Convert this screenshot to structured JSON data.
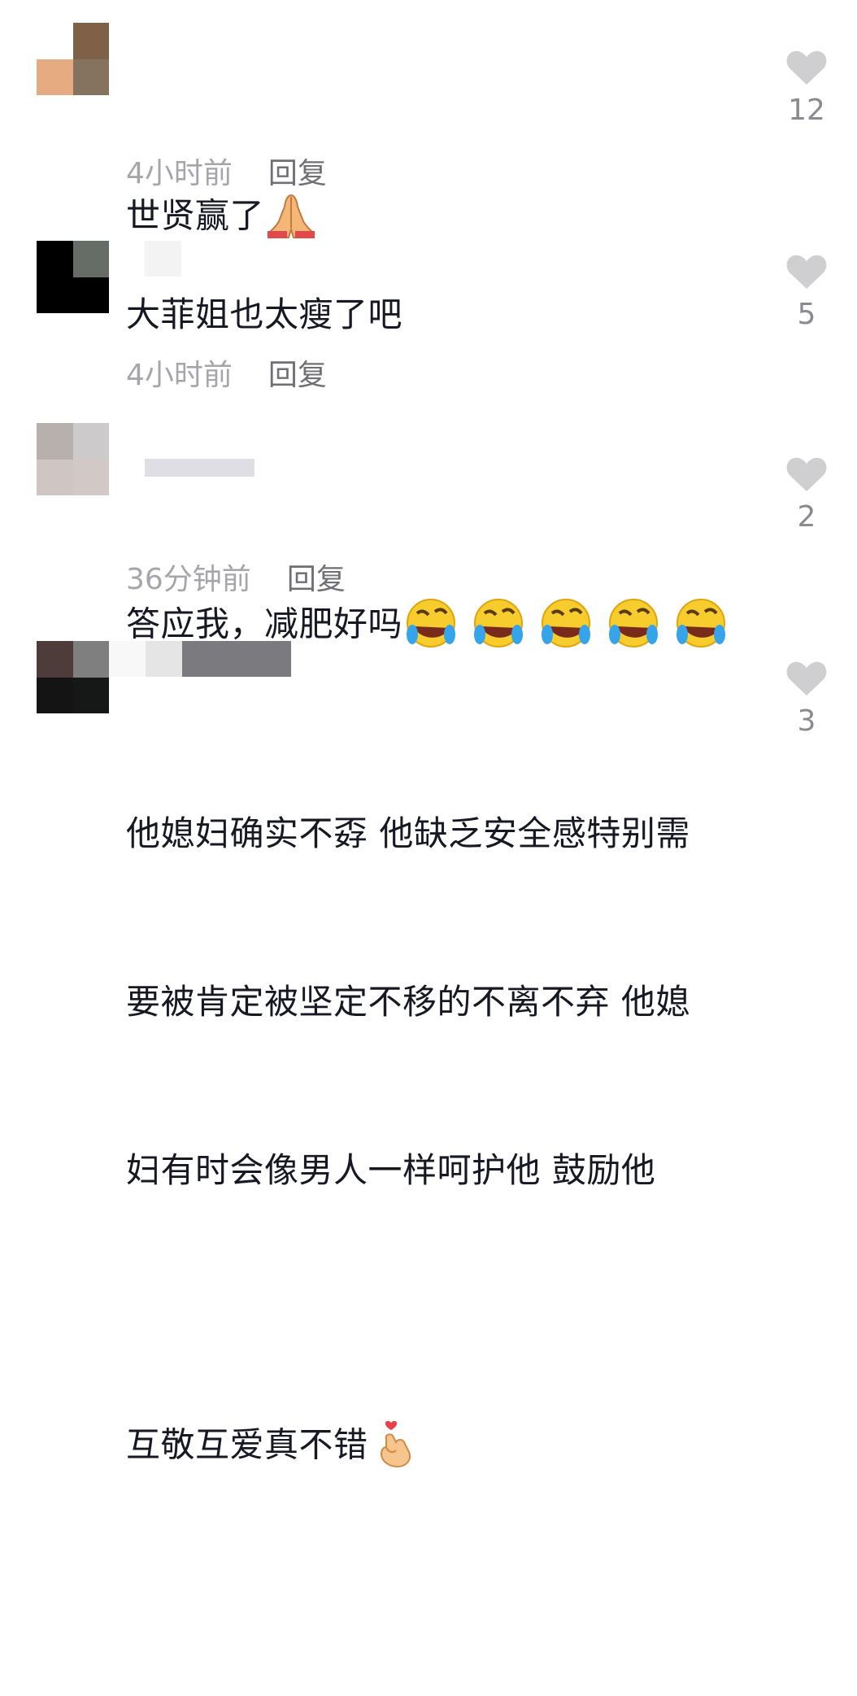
{
  "comments": [
    {
      "text": "世贤赢了",
      "time": "4小时前",
      "reply_label": "回复",
      "likes": "12",
      "emoji": [
        "folded-hands-emoji"
      ],
      "avatar_colors": [
        "#ffffff",
        "#7f6147",
        "#e6ab81",
        "#85725f"
      ],
      "username_colors": []
    },
    {
      "text": "大菲姐也太瘦了吧",
      "time": "4小时前",
      "reply_label": "回复",
      "likes": "5",
      "emoji": [],
      "avatar_colors": [
        "#000000",
        "#656d66",
        "#000000",
        "#000000"
      ],
      "username_colors": [
        "#f3f3f3"
      ]
    },
    {
      "text": "答应我，减肥好吗",
      "time": "36分钟前",
      "reply_label": "回复",
      "likes": "2",
      "emoji": [
        "rolling-on-floor-laughing-emoji",
        "rolling-on-floor-laughing-emoji",
        "rolling-on-floor-laughing-emoji",
        "rolling-on-floor-laughing-emoji",
        "rolling-on-floor-laughing-emoji"
      ],
      "avatar_colors": [
        "#b7b0ad",
        "#cdcacb",
        "#cfc5c3",
        "#d2c9c6"
      ],
      "username_colors": [
        "#dfdee4"
      ]
    },
    {
      "text_lines": [
        "他媳妇确实不孬 他缺乏安全感特别需",
        "要被肯定被坚定不移的不离不弃 他媳",
        "妇有时会像男人一样呵护他 鼓励他",
        "互敬互爱真不错"
      ],
      "likes": "3",
      "emoji": [
        "finger-heart-emoji"
      ],
      "avatar_colors": [
        "#4d3c3a",
        "#7f7f7f",
        "#141414",
        "#161818"
      ],
      "username_colors": [
        "#f8f8f8",
        "#e5e5e5",
        "#7b7b7f"
      ]
    }
  ]
}
